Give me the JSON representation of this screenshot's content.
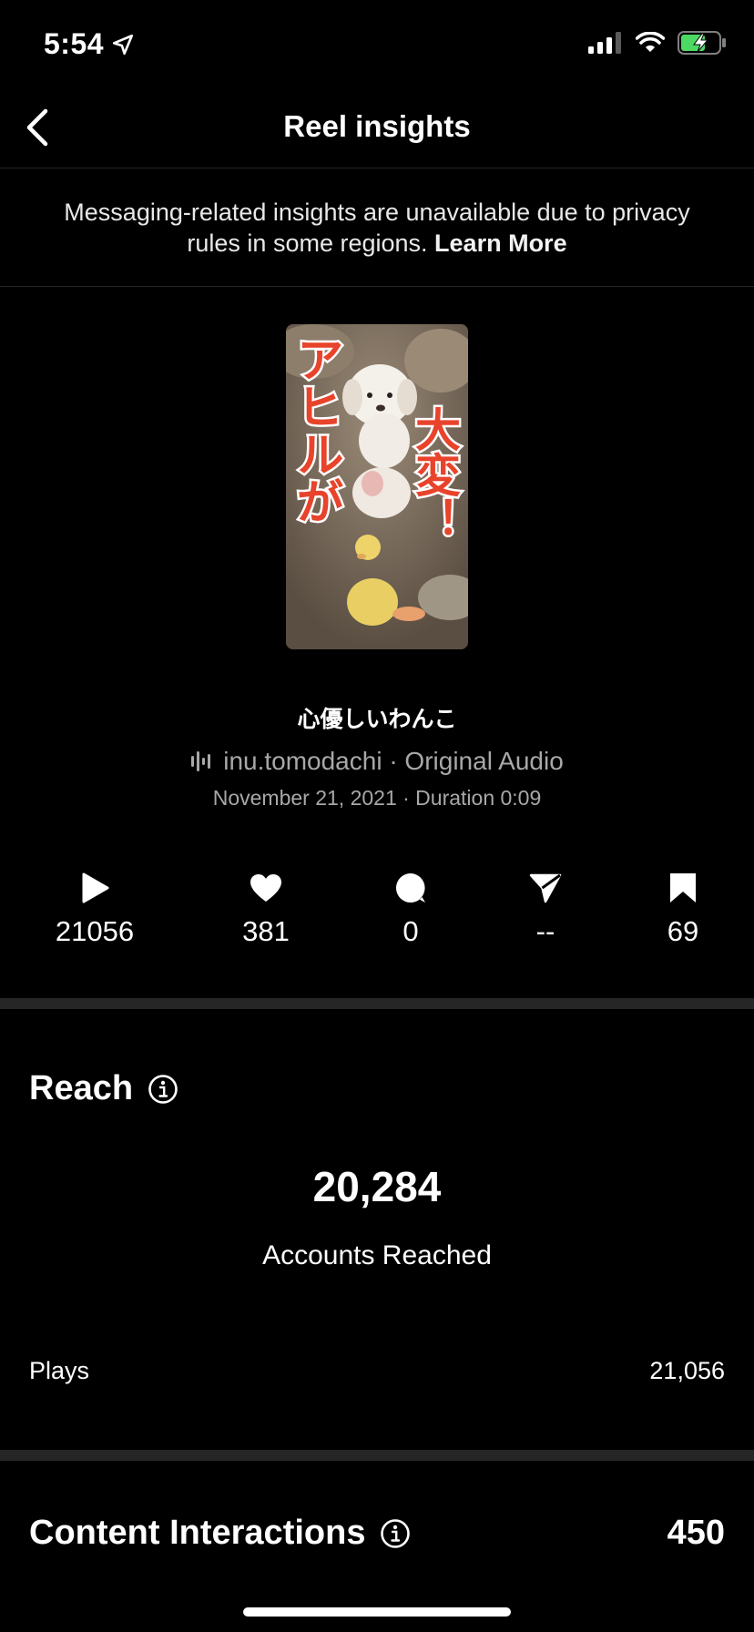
{
  "status_bar": {
    "time": "5:54"
  },
  "nav": {
    "title": "Reel insights"
  },
  "notice": {
    "text": "Messaging-related insights are unavailable due to privacy rules in some regions.",
    "link": "Learn More"
  },
  "reel": {
    "thumbnail_text_left": "アヒルが",
    "thumbnail_text_right": "大変！",
    "title": "心優しいわんこ",
    "audio": "inu.tomodachi · Original Audio",
    "meta": "November 21, 2021 · Duration 0:09"
  },
  "stats": [
    {
      "icon": "play-icon",
      "value": "21056"
    },
    {
      "icon": "heart-icon",
      "value": "381"
    },
    {
      "icon": "comment-icon",
      "value": "0"
    },
    {
      "icon": "share-icon",
      "value": "--"
    },
    {
      "icon": "bookmark-icon",
      "value": "69"
    }
  ],
  "reach": {
    "title": "Reach",
    "accounts_reached_value": "20,284",
    "accounts_reached_label": "Accounts Reached",
    "plays_label": "Plays",
    "plays_value": "21,056"
  },
  "content_interactions": {
    "title": "Content Interactions",
    "value": "450"
  },
  "colors": {
    "background": "#000000",
    "secondary_text": "#a8a8a8",
    "divider": "#262626",
    "battery_green": "#4cd964"
  }
}
